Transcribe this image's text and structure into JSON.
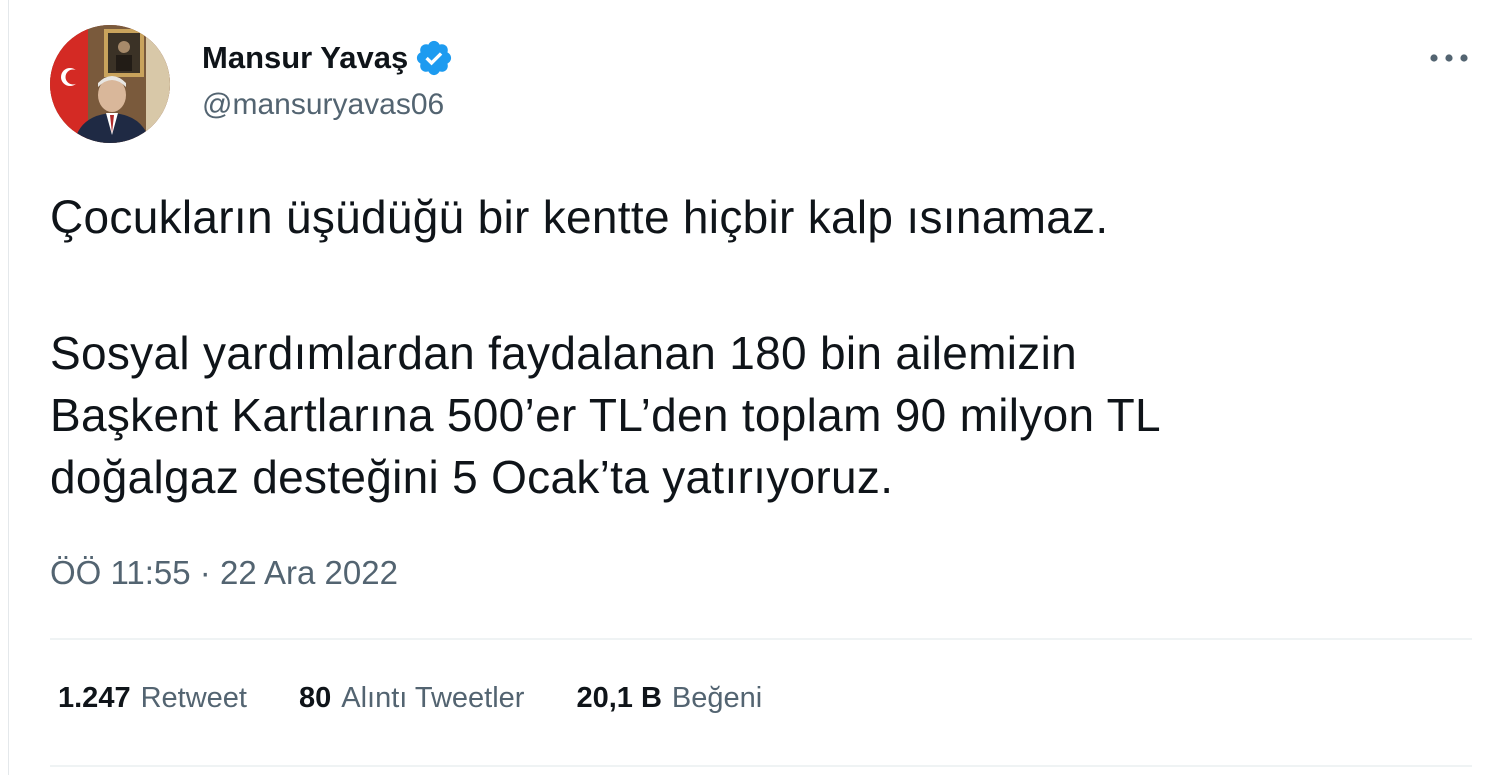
{
  "author": {
    "display_name": "Mansur Yavaş",
    "handle": "@mansuryavas06",
    "verified": true,
    "verified_icon": "verified-badge-icon",
    "verified_color": "#1d9bf0"
  },
  "tweet": {
    "paragraph_1": "Çocukların üşüdüğü bir kentte hiçbir kalp ısınamaz.",
    "paragraph_2_lines": [
      "Sosyal yardımlardan faydalanan 180 bin ailemizin",
      "Başkent Kartlarına 500’er TL’den toplam 90 milyon TL",
      "doğalgaz desteğini 5 Ocak’ta yatırıyoruz."
    ],
    "timestamp": "ÖÖ 11:55 · 22 Ara 2022"
  },
  "stats": {
    "retweets": {
      "count": "1.247",
      "label": "Retweet"
    },
    "quotes": {
      "count": "80",
      "label": "Alıntı Tweetler"
    },
    "likes": {
      "count": "20,1 B",
      "label": "Beğeni"
    }
  },
  "icons": {
    "more": "more-options-icon"
  },
  "colors": {
    "text_primary": "#0f1419",
    "text_secondary": "#536471",
    "divider": "#eff3f4",
    "accent": "#1d9bf0"
  }
}
